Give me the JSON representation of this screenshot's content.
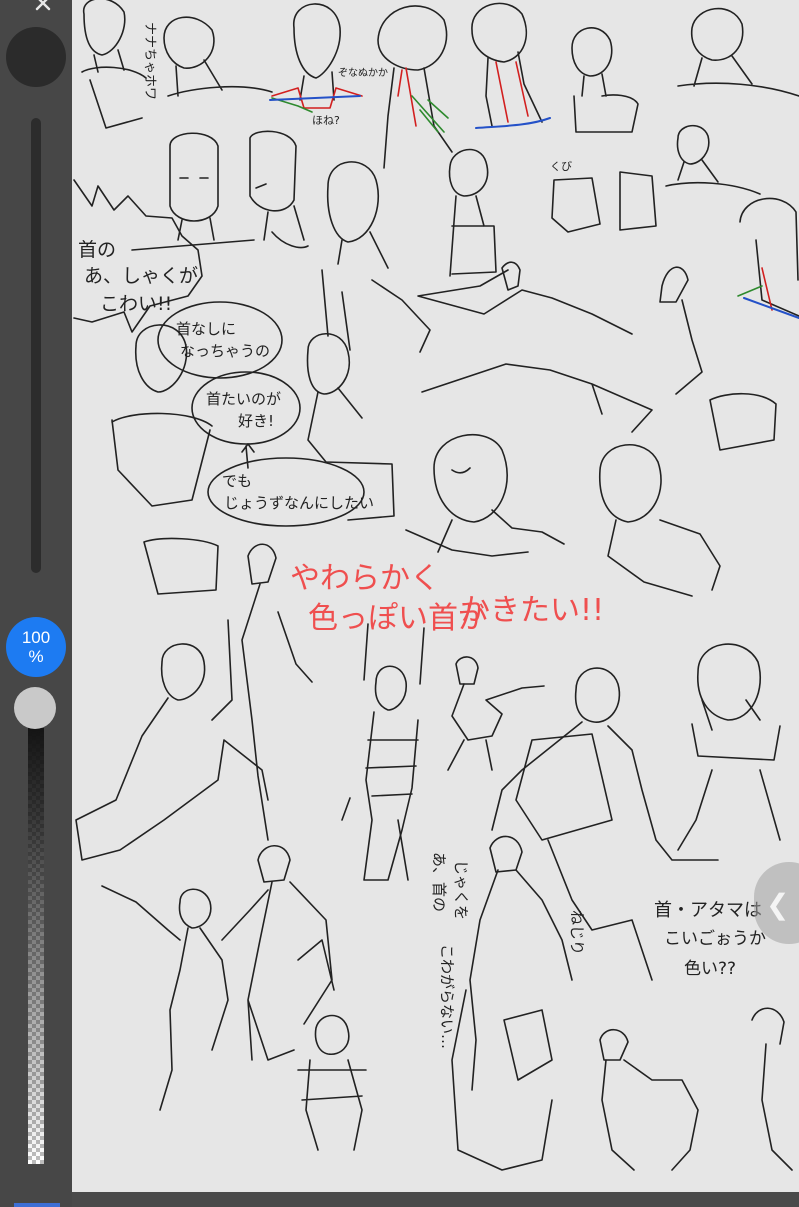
{
  "toolbar": {
    "opacity_value": "100",
    "opacity_unit": "%",
    "opacity_level": 1.0,
    "accent_color": "#1d7bf2",
    "icons": [
      "close-icon",
      "chevron-left-icon"
    ]
  },
  "canvas": {
    "background_color": "#e6e6e6",
    "stroke_color": "#222222",
    "notes": {
      "top_vertical_1": "ナナちゃホワ",
      "neck_small": "ぞなぬかか",
      "neck_small_2": "ほね?",
      "kude": "くび",
      "bubble_line1": "首の",
      "bubble_line2": "あ、しゃくが",
      "bubble_line3": "こわい!!",
      "oval1_line1": "首なしに",
      "oval1_line2": "なっちゃうの",
      "oval2_line1": "首たいのが",
      "oval2_line2": "好き!",
      "oval3_line1": "でも",
      "oval3_line2": "じょうずなんにしたい",
      "red_line1": "やわらかく",
      "red_line2": "色っぽい首が",
      "red_line3": "かきたい!!",
      "mid_vertical_1": "あ、首の",
      "mid_vertical_2": "じゃくを",
      "mid_vertical_3": "こわがらない…",
      "nejiri": "ねじり",
      "right_note_line1": "首・アタマは",
      "right_note_line2": "こいごぉうか",
      "right_note_line3": "色い??"
    }
  }
}
